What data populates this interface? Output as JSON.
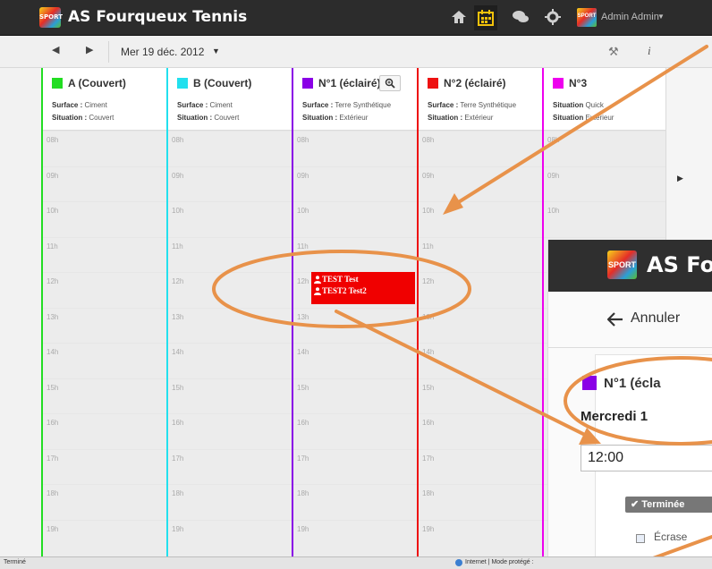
{
  "navbar": {
    "logo_text": "SPORT",
    "brand": "AS Fourqueux Tennis",
    "user_logo_text": "SPORT",
    "user_name": "Admin Admin",
    "icons": [
      "home-icon",
      "calendar-icon",
      "chat-icon",
      "gear-icon"
    ]
  },
  "toolbar": {
    "prev_glyph": "◀",
    "next_glyph": "▶",
    "date": "Mer 19 déc. 2012",
    "caret": "▼",
    "tools_glyph": "⚒",
    "info_glyph": "i"
  },
  "courts": [
    {
      "name": "A (Couvert)",
      "color": "#22dd22",
      "surface_label": "Surface :",
      "surface": "Ciment",
      "situation_label": "Situation :",
      "situation": "Couvert"
    },
    {
      "name": "B (Couvert)",
      "color": "#22e0ee",
      "surface_label": "Surface :",
      "surface": "Ciment",
      "situation_label": "Situation :",
      "situation": "Couvert"
    },
    {
      "name": "N°1 (éclairé)",
      "color": "#8a00e6",
      "surface_label": "Surface :",
      "surface": "Terre Synthétique",
      "situation_label": "Situation :",
      "situation": "Extérieur"
    },
    {
      "name": "N°2 (éclairé)",
      "color": "#ee1111",
      "surface_label": "Surface :",
      "surface": "Terre Synthétique",
      "situation_label": "Situation :",
      "situation": "Extérieur"
    },
    {
      "name": "N°3",
      "color": "#ee00ee",
      "surface_label": "Situation",
      "surface": "Quick",
      "situation_label": "Situation",
      "situation": "Extérieur"
    }
  ],
  "hours": [
    "08h",
    "09h",
    "10h",
    "11h",
    "12h",
    "13h",
    "14h",
    "15h",
    "16h",
    "17h",
    "18h",
    "19h"
  ],
  "booking": {
    "players": [
      "TEST Test",
      "TEST2 Test2"
    ]
  },
  "right_arrow": "▶",
  "popup": {
    "logo_text": "SPORT",
    "brand": "AS Fo",
    "cancel": "Annuler",
    "court": "N°1 (écla",
    "date": "Mercredi 1",
    "time": "12:00",
    "status": "✔ Terminée",
    "checkbox_label": "Écrase"
  },
  "statusbar": {
    "left": "Terminé",
    "right": "Internet | Mode protégé :"
  },
  "annotation_color": "#e8924a"
}
